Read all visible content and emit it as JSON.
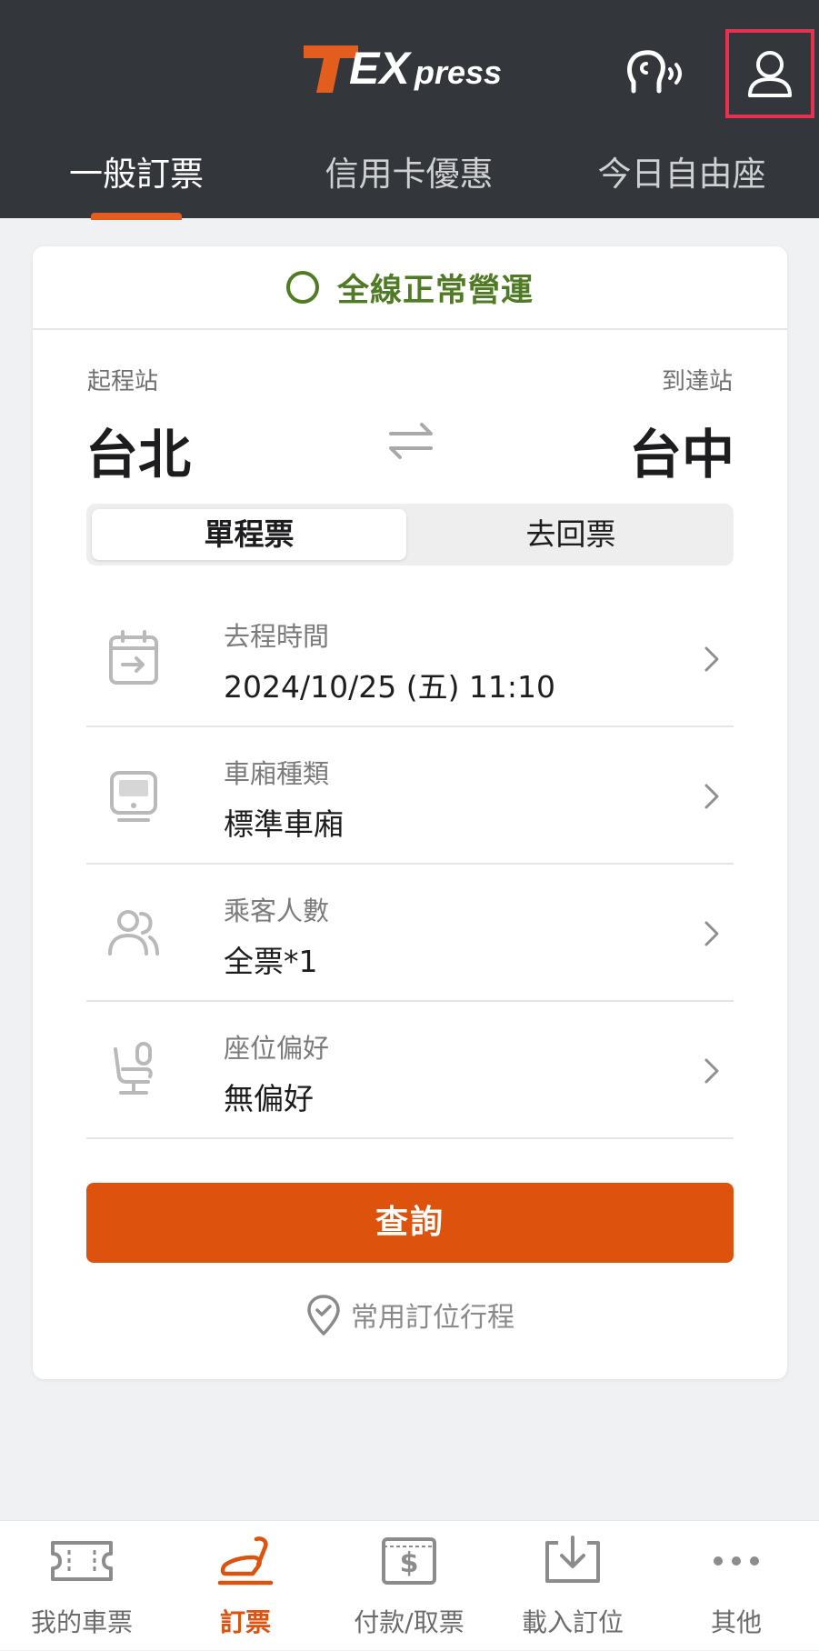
{
  "header": {
    "logo_text_t": "T",
    "logo_text_ex": "EX",
    "logo_text_press": "press",
    "brand_color": "#e35d1e",
    "support_icon": "support-voice-icon",
    "account_icon": "user-icon"
  },
  "tabs": [
    {
      "label": "一般訂票",
      "active": true
    },
    {
      "label": "信用卡優惠",
      "active": false
    },
    {
      "label": "今日自由座",
      "active": false
    }
  ],
  "status": {
    "text": "全線正常營運",
    "color": "#4e7b23"
  },
  "stations": {
    "from_label": "起程站",
    "from": "台北",
    "to_label": "到達站",
    "to": "台中"
  },
  "trip_type": {
    "single": "單程票",
    "round": "去回票",
    "selected": "single"
  },
  "rows": [
    {
      "label": "去程時間",
      "value": "2024/10/25 (五) 11:10",
      "icon": "calendar-icon"
    },
    {
      "label": "車廂種類",
      "value": "標準車廂",
      "icon": "train-icon"
    },
    {
      "label": "乘客人數",
      "value": "全票*1",
      "icon": "passengers-icon"
    },
    {
      "label": "座位偏好",
      "value": "無偏好",
      "icon": "seat-icon"
    }
  ],
  "search_button": "查詢",
  "favorite_link": "常用訂位行程",
  "bottom_nav": [
    {
      "label": "我的車票",
      "icon": "ticket-icon",
      "active": false
    },
    {
      "label": "訂票",
      "icon": "seat-booking-icon",
      "active": true
    },
    {
      "label": "付款/取票",
      "icon": "payment-icon",
      "active": false
    },
    {
      "label": "載入訂位",
      "icon": "download-icon",
      "active": false
    },
    {
      "label": "其他",
      "icon": "more-icon",
      "active": false
    }
  ],
  "accent_color": "#dd520d"
}
